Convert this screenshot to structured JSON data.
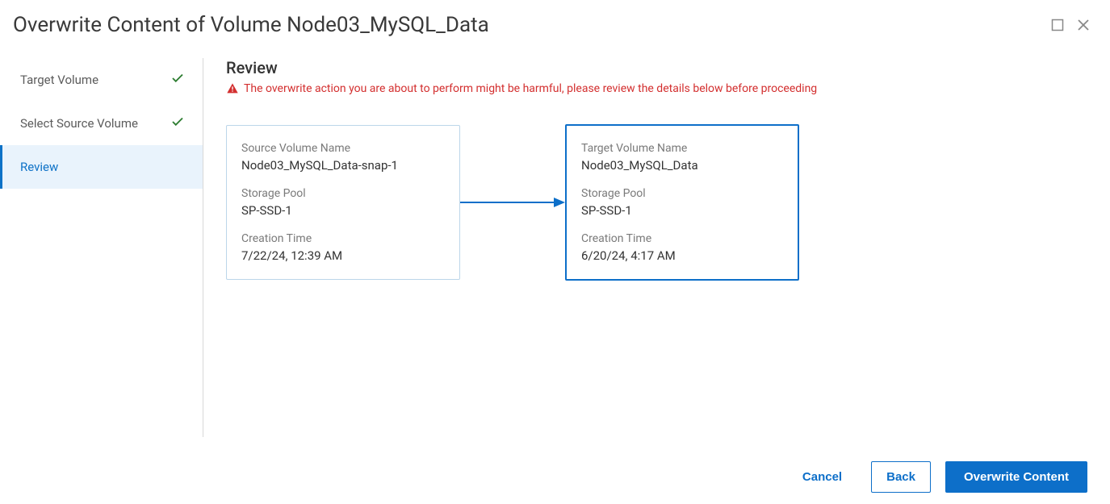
{
  "dialog": {
    "title": "Overwrite Content of Volume Node03_MySQL_Data"
  },
  "steps": [
    {
      "label": "Target Volume",
      "completed": true,
      "active": false
    },
    {
      "label": "Select Source Volume",
      "completed": true,
      "active": false
    },
    {
      "label": "Review",
      "completed": false,
      "active": true
    }
  ],
  "review": {
    "heading": "Review",
    "warning": "The overwrite action you are about to perform might be harmful, please review the details below before proceeding"
  },
  "source": {
    "name_label": "Source Volume Name",
    "name": "Node03_MySQL_Data-snap-1",
    "pool_label": "Storage Pool",
    "pool": "SP-SSD-1",
    "time_label": "Creation Time",
    "time": "7/22/24, 12:39 AM"
  },
  "target": {
    "name_label": "Target Volume Name",
    "name": "Node03_MySQL_Data",
    "pool_label": "Storage Pool",
    "pool": "SP-SSD-1",
    "time_label": "Creation Time",
    "time": "6/20/24, 4:17 AM"
  },
  "footer": {
    "cancel": "Cancel",
    "back": "Back",
    "primary": "Overwrite Content"
  },
  "colors": {
    "accent": "#0d6fc9",
    "danger": "#d32f2f",
    "success": "#2e7d32"
  }
}
